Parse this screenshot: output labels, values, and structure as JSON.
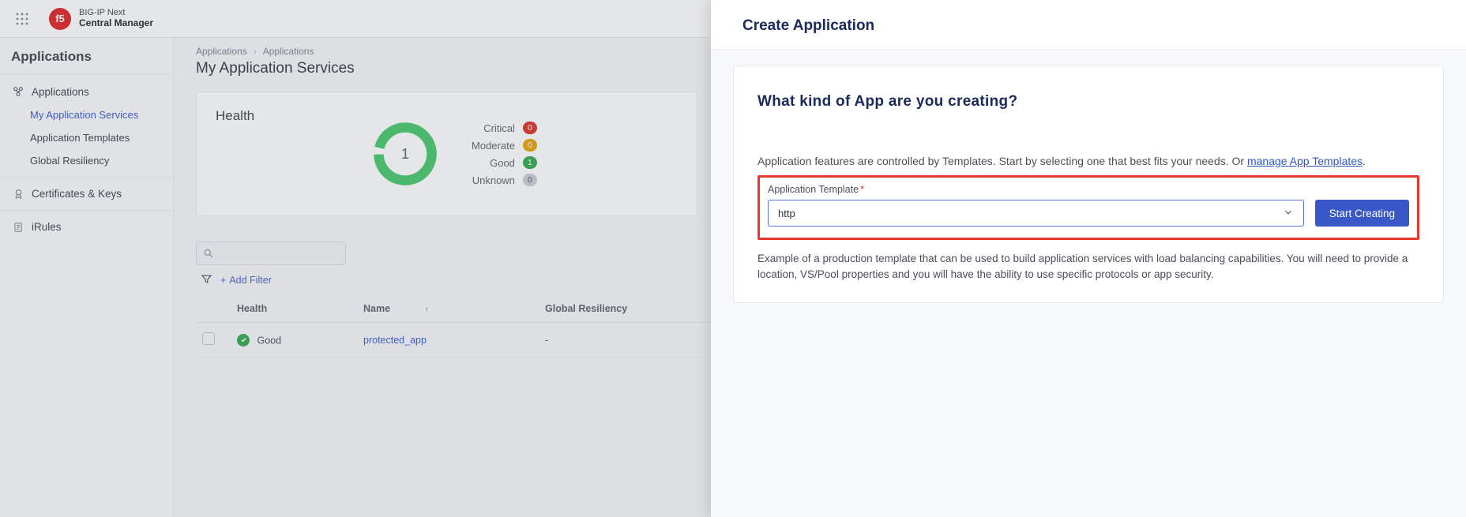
{
  "brand": {
    "line1": "BIG-IP Next",
    "line2": "Central Manager"
  },
  "sidebar": {
    "heading": "Applications",
    "apps": {
      "group": "Applications",
      "items": [
        "My Application Services",
        "Application Templates",
        "Global Resiliency"
      ],
      "active_index": 0
    },
    "certs": "Certificates & Keys",
    "irules": "iRules"
  },
  "breadcrumb": {
    "a": "Applications",
    "b": "Applications"
  },
  "page_title": "My Application Services",
  "health": {
    "title": "Health",
    "total": "1",
    "legend": {
      "critical": {
        "label": "Critical",
        "value": "0"
      },
      "moderate": {
        "label": "Moderate",
        "value": "0"
      },
      "good": {
        "label": "Good",
        "value": "1"
      },
      "unknown": {
        "label": "Unknown",
        "value": "0"
      }
    }
  },
  "toolbar": {
    "add_filter": "Add Filter"
  },
  "table": {
    "cols": {
      "health": "Health",
      "name": "Name",
      "gr": "Global Resiliency"
    },
    "rows": [
      {
        "health": "Good",
        "name": "protected_app",
        "gr": "-"
      }
    ]
  },
  "panel": {
    "title": "Create Application",
    "question": "What kind of App are you creating?",
    "desc_pre": "Application features are controlled by Templates. Start by selecting one that best fits your needs. Or ",
    "desc_link": "manage App Templates",
    "desc_post": ".",
    "template_label": "Application Template",
    "template_value": "http",
    "start_btn": "Start Creating",
    "help": "Example of a production template that can be used to build application services with load balancing capabilities. You will need to provide a location, VS/Pool properties and you will have the ability to use specific protocols or app security."
  }
}
